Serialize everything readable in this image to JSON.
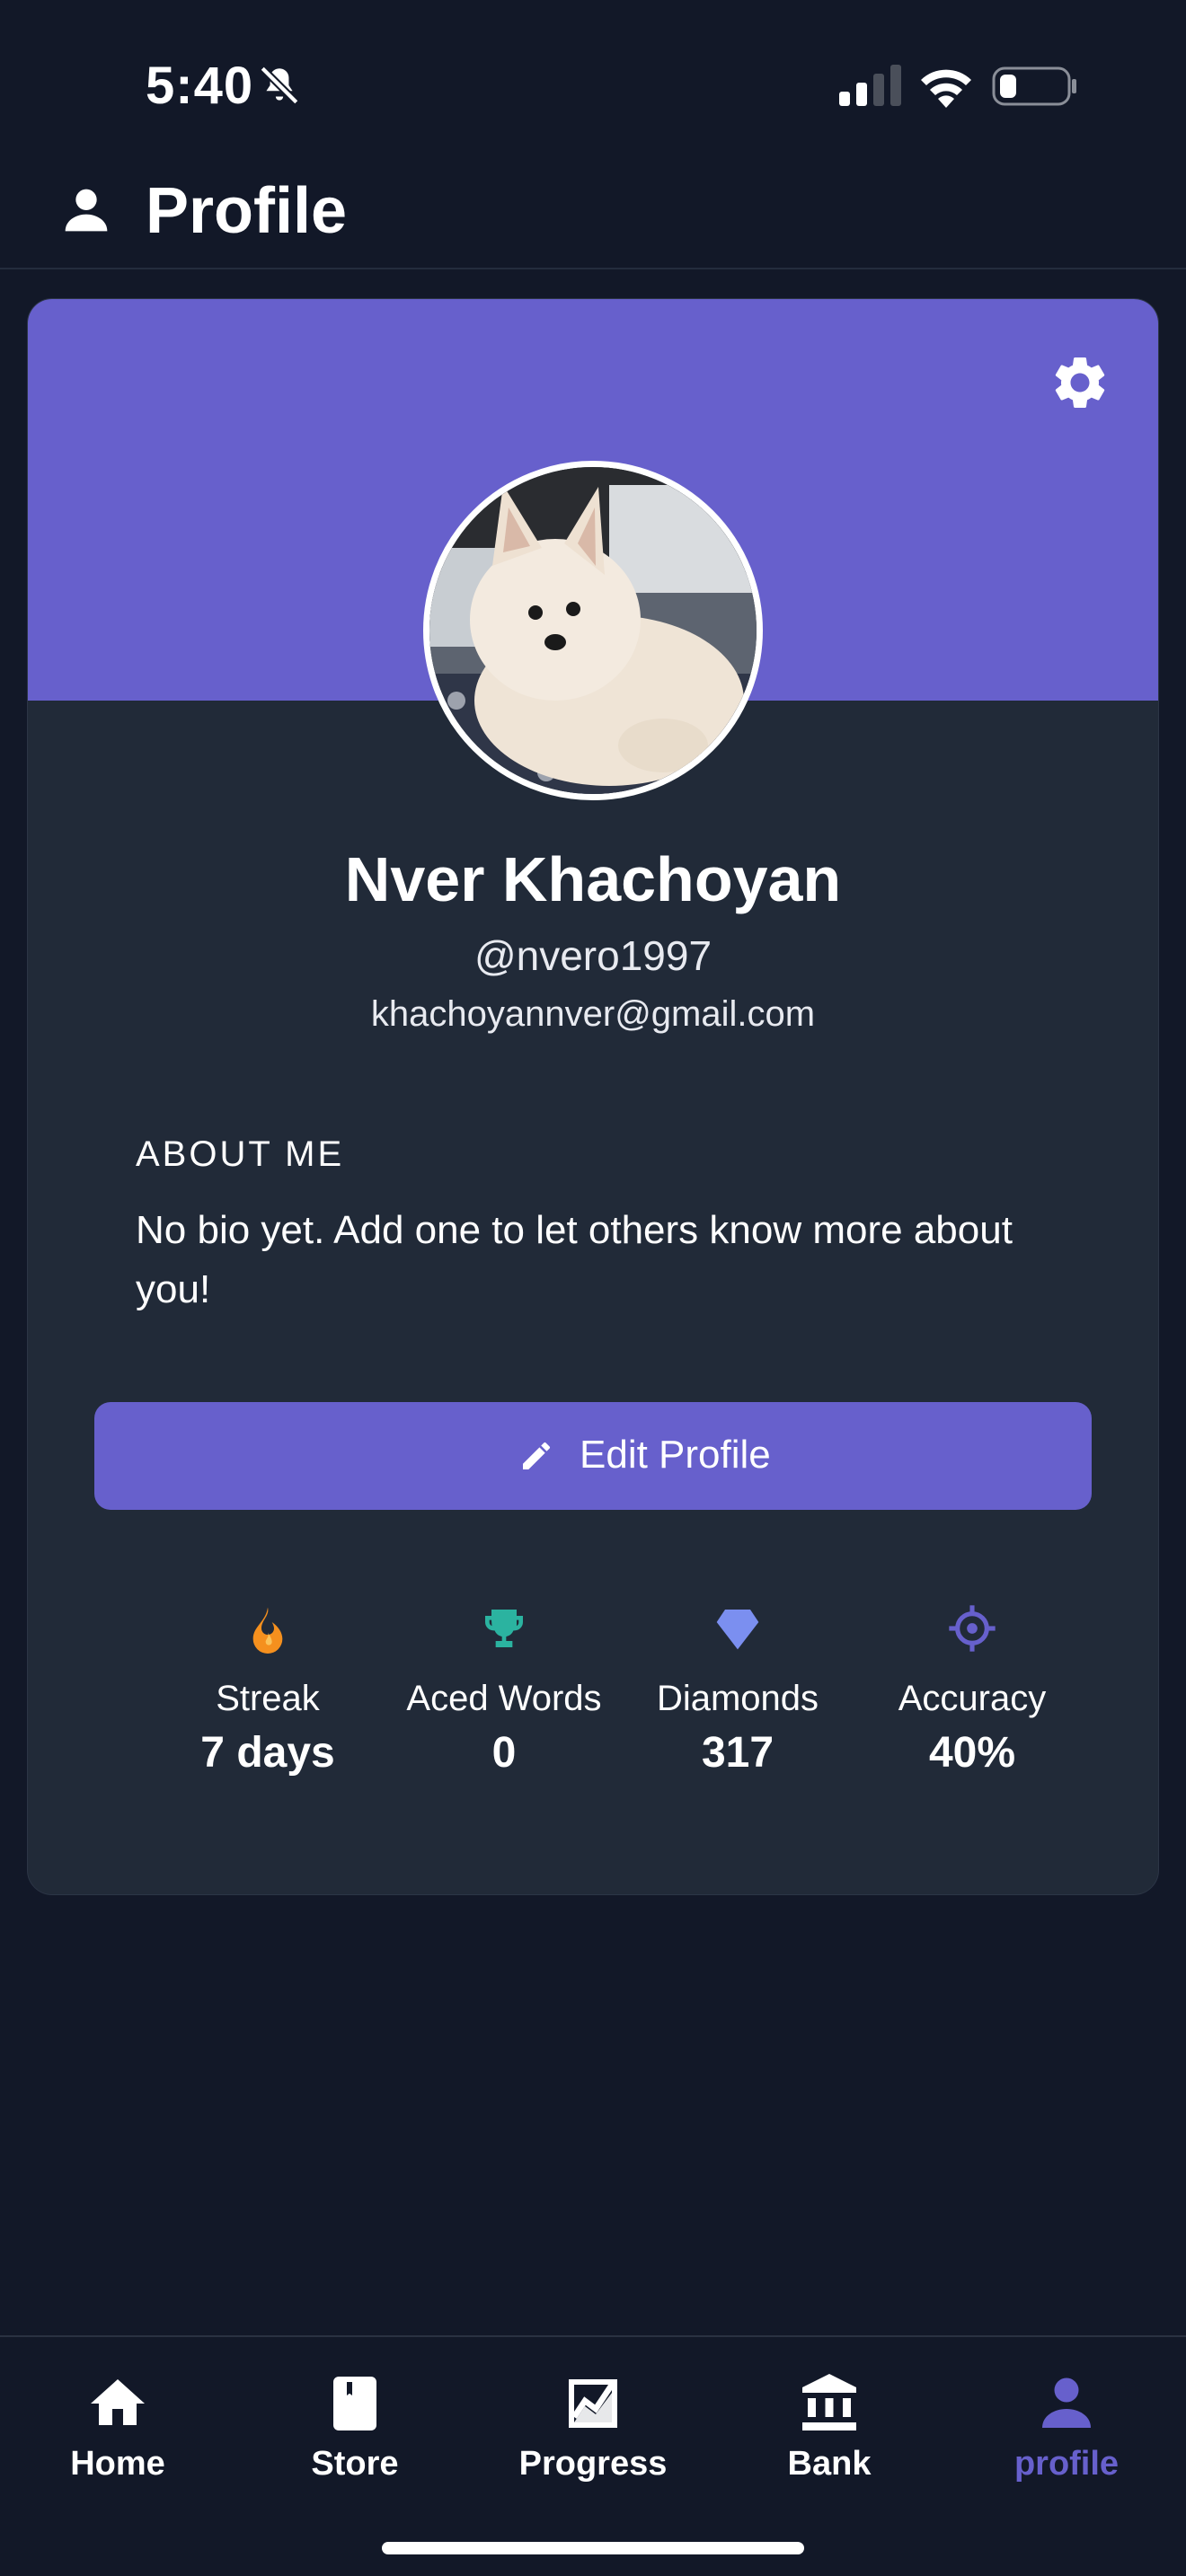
{
  "status_bar": {
    "time": "5:40"
  },
  "header": {
    "title": "Profile",
    "icon": "person-icon"
  },
  "profile": {
    "name": "Nver Khachoyan",
    "username": "@nvero1997",
    "email": "khachoyannver@gmail.com",
    "avatar": "dog-photo"
  },
  "about": {
    "heading": "ABOUT ME",
    "text": "No bio yet. Add one to let others know more about you!"
  },
  "edit_button": {
    "label": "Edit Profile",
    "icon": "pencil-icon"
  },
  "stats": [
    {
      "label": "Streak",
      "value": "7 days",
      "icon": "flame-icon",
      "color": "#f5901e"
    },
    {
      "label": "Aced Words",
      "value": "0",
      "icon": "trophy-icon",
      "color": "#2bb3a0"
    },
    {
      "label": "Diamonds",
      "value": "317",
      "icon": "diamond-icon",
      "color": "#7b8ff0"
    },
    {
      "label": "Accuracy",
      "value": "40%",
      "icon": "crosshair-icon",
      "color": "#6760cc"
    }
  ],
  "nav": [
    {
      "label": "Home",
      "icon": "home-icon",
      "active": false
    },
    {
      "label": "Store",
      "icon": "book-icon",
      "active": false
    },
    {
      "label": "Progress",
      "icon": "chart-icon",
      "active": false
    },
    {
      "label": "Bank",
      "icon": "bank-icon",
      "active": false
    },
    {
      "label": "profile",
      "icon": "person-icon",
      "active": true
    }
  ],
  "colors": {
    "background": "#121828",
    "card": "#212a38",
    "accent": "#6760cc"
  }
}
